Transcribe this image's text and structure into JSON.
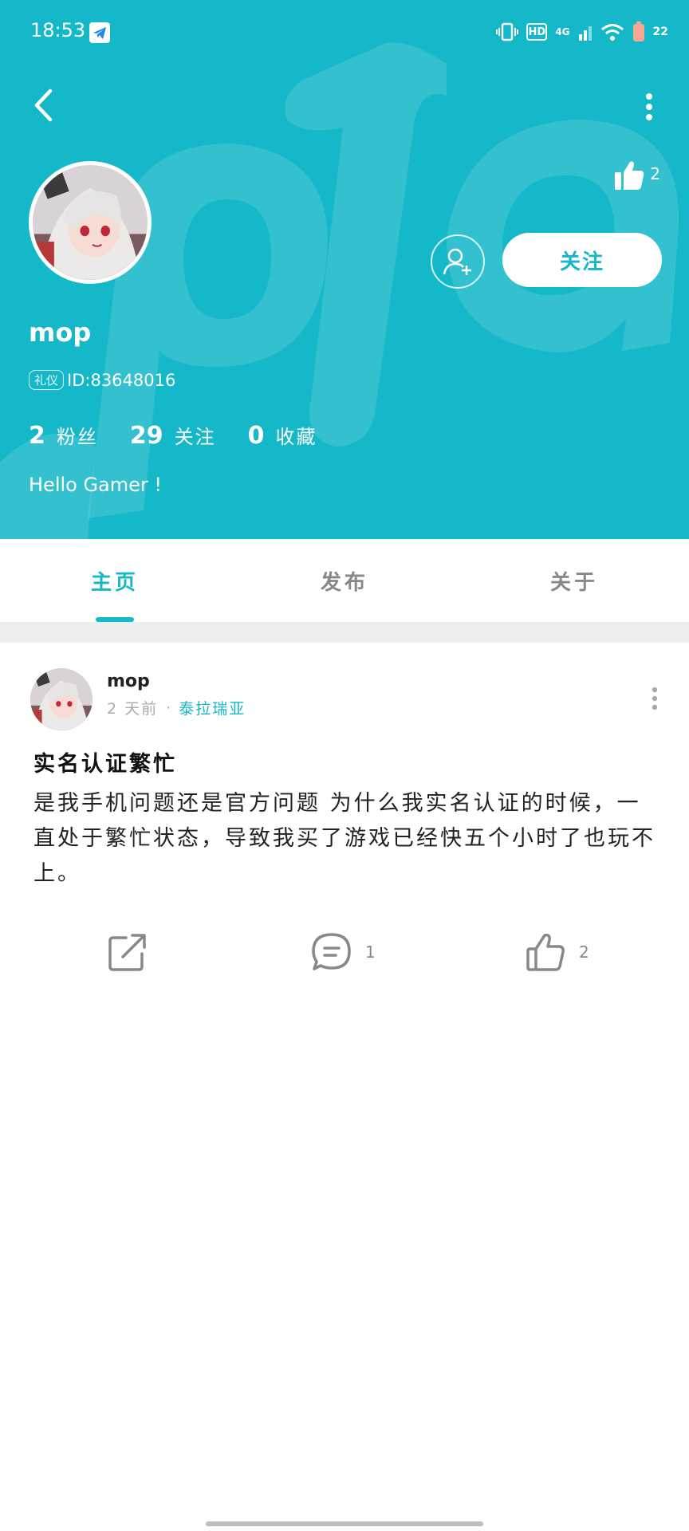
{
  "status_bar": {
    "time": "18:53",
    "hd_label": "HD",
    "network_label": "4G",
    "battery_level": "22",
    "icons": [
      "telegram-icon",
      "vibrate-icon",
      "signal-icon",
      "wifi-icon",
      "battery-icon"
    ]
  },
  "header": {
    "like_count": "2",
    "follow_label": "关注",
    "background_color": "#15b8c8"
  },
  "profile": {
    "username": "mop",
    "badge": "礼仪",
    "id_text": "ID:83648016",
    "bio": "Hello Gamer !",
    "stats": [
      {
        "value": "2",
        "label": "粉丝"
      },
      {
        "value": "29",
        "label": "关注"
      },
      {
        "value": "0",
        "label": "收藏"
      }
    ]
  },
  "tabs": [
    {
      "label": "主页",
      "active": true
    },
    {
      "label": "发布",
      "active": false
    },
    {
      "label": "关于",
      "active": false
    }
  ],
  "post": {
    "author": "mop",
    "time": "2 天前",
    "separator": "·",
    "game": "泰拉瑞亚",
    "title": "实名认证繁忙",
    "body": "是我手机问题还是官方问题 为什么我实名认证的时候，一直处于繁忙状态，导致我买了游戏已经快五个小时了也玩不上。",
    "comment_count": "1",
    "like_count": "2"
  },
  "colors": {
    "accent": "#15b8c8",
    "muted": "#888888",
    "divider": "#eeeeee"
  }
}
